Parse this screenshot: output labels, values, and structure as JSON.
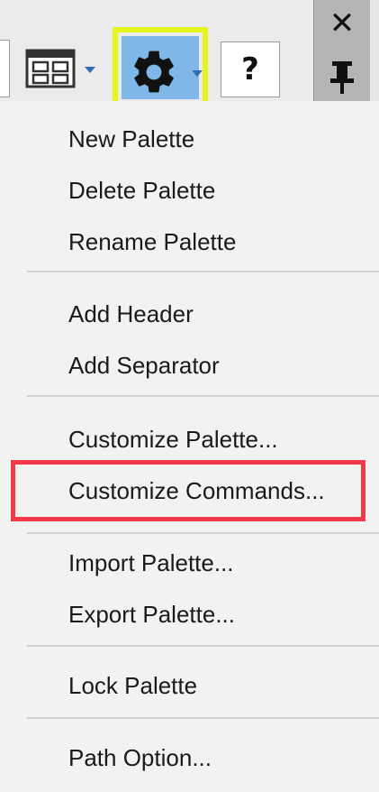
{
  "toolbar": {
    "layout_button_icon": "palette-layout-icon",
    "settings_button_icon": "gear-icon",
    "settings_highlight_color": "#e6f51c",
    "help_label": "?",
    "close_label": "✕",
    "pin_icon": "pin-icon"
  },
  "menu": {
    "items": [
      {
        "label": "New Palette"
      },
      {
        "label": "Delete Palette"
      },
      {
        "label": "Rename Palette"
      },
      {
        "label": "Add Header"
      },
      {
        "label": "Add Separator"
      },
      {
        "label": "Customize Palette..."
      },
      {
        "label": "Customize Commands..."
      },
      {
        "label": "Import Palette..."
      },
      {
        "label": "Export Palette..."
      },
      {
        "label": "Lock Palette"
      },
      {
        "label": "Path Option..."
      }
    ],
    "highlighted_item": "Customize Commands...",
    "highlight_color": "#ef3b47"
  }
}
